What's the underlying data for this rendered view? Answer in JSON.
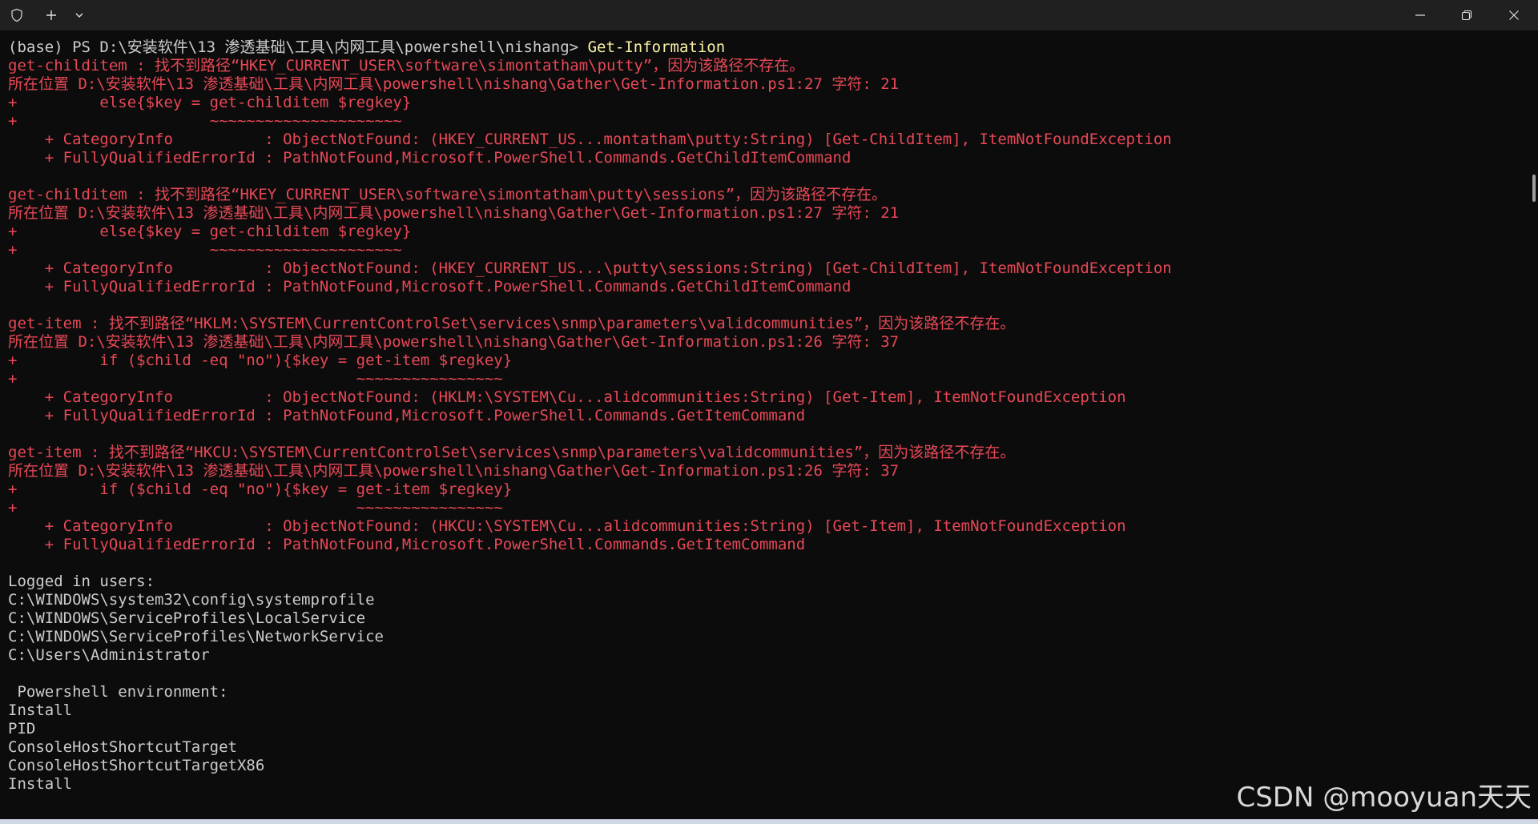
{
  "window": {
    "icon_names": {
      "shield": "shield-icon",
      "new_tab": "plus-icon",
      "dropdown": "chevron-down-icon",
      "minimize": "minimize-icon",
      "restore": "restore-icon",
      "close": "close-icon"
    },
    "colors": {
      "background": "#0c0c0c",
      "titlebar": "#202020",
      "normal_text": "#cccccc",
      "error_text": "#e74856",
      "command_text": "#f9f1a5"
    }
  },
  "terminal": {
    "prompt": "(base) PS D:\\安装软件\\13 渗透基础\\工具\\内网工具\\powershell\\nishang> ",
    "command": "Get-Information",
    "lines": [
      {
        "kind": "err",
        "text": "get-childitem : 找不到路径“HKEY_CURRENT_USER\\software\\simontatham\\putty”，因为该路径不存在。"
      },
      {
        "kind": "err",
        "text": "所在位置 D:\\安装软件\\13 渗透基础\\工具\\内网工具\\powershell\\nishang\\Gather\\Get-Information.ps1:27 字符: 21"
      },
      {
        "kind": "err",
        "text": "+         else{$key = get-childitem $regkey}"
      },
      {
        "kind": "err",
        "text": "+                     ~~~~~~~~~~~~~~~~~~~~~"
      },
      {
        "kind": "err",
        "text": "    + CategoryInfo          : ObjectNotFound: (HKEY_CURRENT_US...montatham\\putty:String) [Get-ChildItem], ItemNotFoundException"
      },
      {
        "kind": "err",
        "text": "    + FullyQualifiedErrorId : PathNotFound,Microsoft.PowerShell.Commands.GetChildItemCommand"
      },
      {
        "kind": "err",
        "text": ""
      },
      {
        "kind": "err",
        "text": "get-childitem : 找不到路径“HKEY_CURRENT_USER\\software\\simontatham\\putty\\sessions”，因为该路径不存在。"
      },
      {
        "kind": "err",
        "text": "所在位置 D:\\安装软件\\13 渗透基础\\工具\\内网工具\\powershell\\nishang\\Gather\\Get-Information.ps1:27 字符: 21"
      },
      {
        "kind": "err",
        "text": "+         else{$key = get-childitem $regkey}"
      },
      {
        "kind": "err",
        "text": "+                     ~~~~~~~~~~~~~~~~~~~~~"
      },
      {
        "kind": "err",
        "text": "    + CategoryInfo          : ObjectNotFound: (HKEY_CURRENT_US...\\putty\\sessions:String) [Get-ChildItem], ItemNotFoundException"
      },
      {
        "kind": "err",
        "text": "    + FullyQualifiedErrorId : PathNotFound,Microsoft.PowerShell.Commands.GetChildItemCommand"
      },
      {
        "kind": "err",
        "text": ""
      },
      {
        "kind": "err",
        "text": "get-item : 找不到路径“HKLM:\\SYSTEM\\CurrentControlSet\\services\\snmp\\parameters\\validcommunities”，因为该路径不存在。"
      },
      {
        "kind": "err",
        "text": "所在位置 D:\\安装软件\\13 渗透基础\\工具\\内网工具\\powershell\\nishang\\Gather\\Get-Information.ps1:26 字符: 37"
      },
      {
        "kind": "err",
        "text": "+         if ($child -eq \"no\"){$key = get-item $regkey}"
      },
      {
        "kind": "err",
        "text": "+                                     ~~~~~~~~~~~~~~~~"
      },
      {
        "kind": "err",
        "text": "    + CategoryInfo          : ObjectNotFound: (HKLM:\\SYSTEM\\Cu...alidcommunities:String) [Get-Item], ItemNotFoundException"
      },
      {
        "kind": "err",
        "text": "    + FullyQualifiedErrorId : PathNotFound,Microsoft.PowerShell.Commands.GetItemCommand"
      },
      {
        "kind": "err",
        "text": ""
      },
      {
        "kind": "err",
        "text": "get-item : 找不到路径“HKCU:\\SYSTEM\\CurrentControlSet\\services\\snmp\\parameters\\validcommunities”，因为该路径不存在。"
      },
      {
        "kind": "err",
        "text": "所在位置 D:\\安装软件\\13 渗透基础\\工具\\内网工具\\powershell\\nishang\\Gather\\Get-Information.ps1:26 字符: 37"
      },
      {
        "kind": "err",
        "text": "+         if ($child -eq \"no\"){$key = get-item $regkey}"
      },
      {
        "kind": "err",
        "text": "+                                     ~~~~~~~~~~~~~~~~"
      },
      {
        "kind": "err",
        "text": "    + CategoryInfo          : ObjectNotFound: (HKCU:\\SYSTEM\\Cu...alidcommunities:String) [Get-Item], ItemNotFoundException"
      },
      {
        "kind": "err",
        "text": "    + FullyQualifiedErrorId : PathNotFound,Microsoft.PowerShell.Commands.GetItemCommand"
      },
      {
        "kind": "out",
        "text": ""
      },
      {
        "kind": "out",
        "text": "Logged in users:"
      },
      {
        "kind": "out",
        "text": "C:\\WINDOWS\\system32\\config\\systemprofile"
      },
      {
        "kind": "out",
        "text": "C:\\WINDOWS\\ServiceProfiles\\LocalService"
      },
      {
        "kind": "out",
        "text": "C:\\WINDOWS\\ServiceProfiles\\NetworkService"
      },
      {
        "kind": "out",
        "text": "C:\\Users\\Administrator"
      },
      {
        "kind": "out",
        "text": ""
      },
      {
        "kind": "out",
        "text": " Powershell environment:"
      },
      {
        "kind": "out",
        "text": "Install"
      },
      {
        "kind": "out",
        "text": "PID"
      },
      {
        "kind": "out",
        "text": "ConsoleHostShortcutTarget"
      },
      {
        "kind": "out",
        "text": "ConsoleHostShortcutTargetX86"
      },
      {
        "kind": "out",
        "text": "Install"
      }
    ]
  },
  "watermark": "CSDN @mooyuan天天"
}
